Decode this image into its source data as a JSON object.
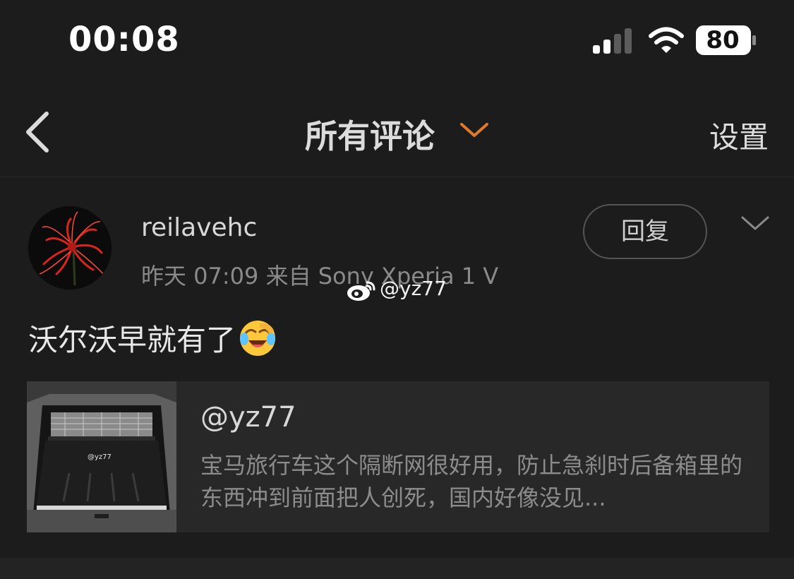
{
  "status": {
    "time": "00:08",
    "battery": "80"
  },
  "nav": {
    "title": "所有评论",
    "settings_label": "设置"
  },
  "comment": {
    "username": "reilavehc",
    "meta": "昨天 07:09  来自 Sony Xperia 1 V",
    "text": "沃尔沃早就有了",
    "emoji": "laughing-crying-emoji",
    "reply_label": "回复"
  },
  "watermark": {
    "text": "@yz77"
  },
  "quote": {
    "author": "@yz77",
    "body": "宝马旅行车这个隔断网很好用，防止急刹时后备箱里的东西冲到前面把人创死，国内好像没见...",
    "thumb_watermark": "@yz77"
  },
  "icons": {
    "back": "back-chevron-icon",
    "dropdown": "chevron-down-icon",
    "more": "chevron-down-icon",
    "signal": "signal-bars-icon",
    "wifi": "wifi-icon",
    "battery": "battery-icon"
  },
  "colors": {
    "accent": "#e07a2c",
    "background": "#1c1c1c",
    "card": "#282828"
  }
}
